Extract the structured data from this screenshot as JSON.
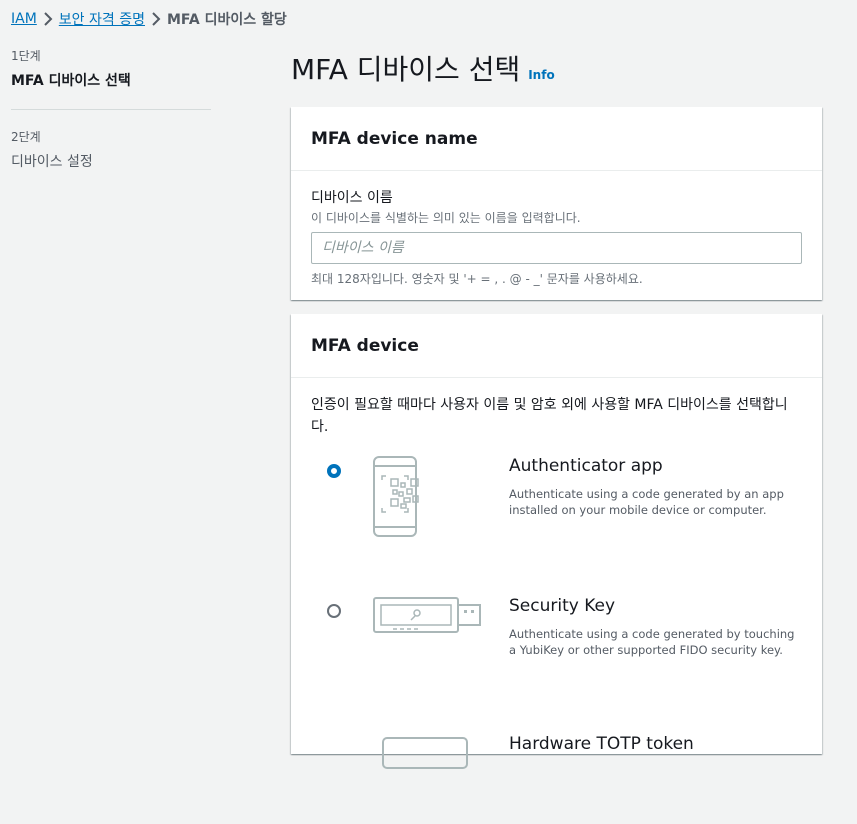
{
  "breadcrumb": {
    "items": [
      "IAM",
      "보안 자격 증명",
      "MFA 디바이스 할당"
    ]
  },
  "steps": [
    {
      "number": "1단계",
      "title": "MFA 디바이스 선택",
      "active": true
    },
    {
      "number": "2단계",
      "title": "디바이스 설정",
      "active": false
    }
  ],
  "page": {
    "title": "MFA 디바이스 선택",
    "info": "Info"
  },
  "device_name_card": {
    "title": "MFA device name",
    "field_label": "디바이스 이름",
    "field_desc": "이 디바이스를 식별하는 의미 있는 이름을 입력합니다.",
    "value": "",
    "placeholder": "디바이스 이름",
    "constraint": "최대 128자입니다. 영숫자 및 '+ = , . @ - _' 문자를 사용하세요."
  },
  "device_card": {
    "title": "MFA device",
    "instruction": "인증이 필요할 때마다 사용자 이름 및 암호 외에 사용할 MFA 디바이스를 선택합니다.",
    "options": [
      {
        "title": "Authenticator app",
        "desc": "Authenticate using a code generated by an app installed on your mobile device or computer.",
        "selected": true,
        "icon": "phone-qr-icon"
      },
      {
        "title": "Security Key",
        "desc": "Authenticate using a code generated by touching a YubiKey or other supported FIDO security key.",
        "selected": false,
        "icon": "usb-key-icon"
      },
      {
        "title": "Hardware TOTP token",
        "desc": "",
        "selected": false,
        "icon": "hardware-token-icon"
      }
    ]
  },
  "colors": {
    "link": "#0073bb",
    "text": "#16191f",
    "muted": "#545b64",
    "background": "#f2f3f3"
  }
}
